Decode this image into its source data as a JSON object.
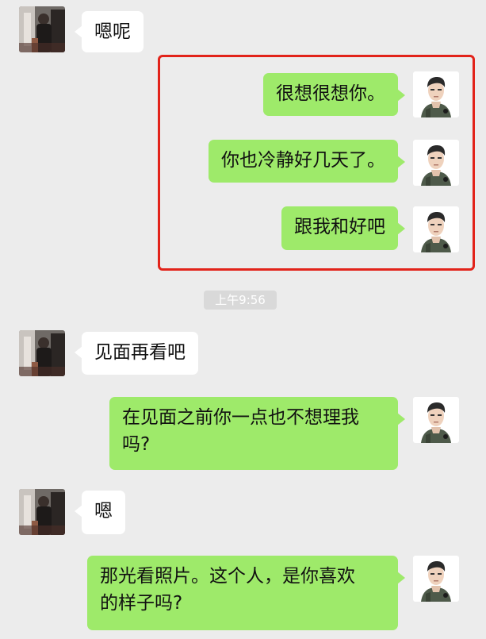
{
  "conversation": {
    "timestamp": "上午9:56",
    "messages": [
      {
        "sender": "contact",
        "text": "嗯呢"
      },
      {
        "sender": "me",
        "text": "很想很想你。"
      },
      {
        "sender": "me",
        "text": "你也冷静好几天了。"
      },
      {
        "sender": "me",
        "text": "跟我和好吧"
      },
      {
        "sender": "contact",
        "text": "见面再看吧"
      },
      {
        "sender": "me",
        "text": "在见面之前你一点也不想理我\n吗?"
      },
      {
        "sender": "contact",
        "text": "嗯"
      },
      {
        "sender": "me",
        "text": "那光看照片。这个人，是你喜欢\n的样子吗?"
      }
    ]
  },
  "colors": {
    "background": "#ececec",
    "outgoing_bubble": "#9eea6a",
    "incoming_bubble": "#ffffff",
    "highlight_border": "#e2231a",
    "timestamp_pill": "#d9d9d9"
  },
  "icons": {
    "contact_avatar": "contact-avatar-photo",
    "user_avatar": "illustrated-man-avatar"
  }
}
